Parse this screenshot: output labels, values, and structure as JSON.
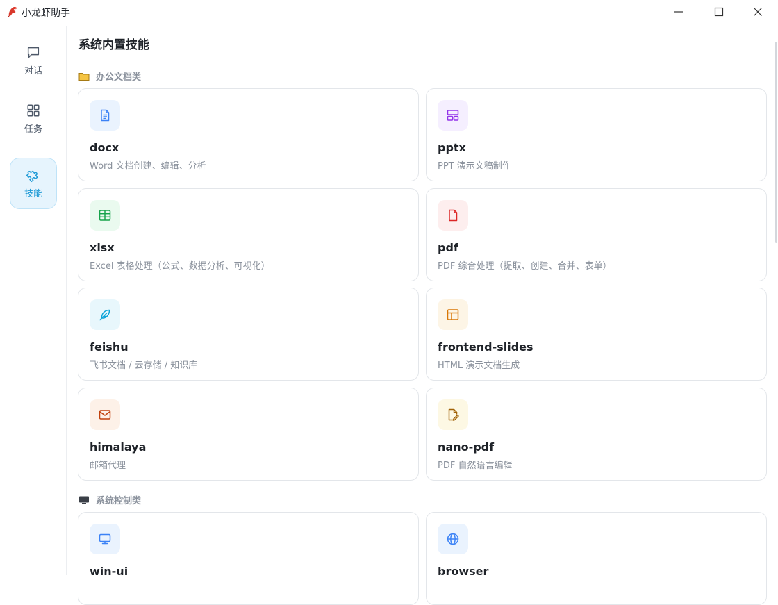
{
  "window": {
    "title": "小龙虾助手",
    "controls": {
      "minimize": "minimize-icon",
      "maximize": "maximize-icon",
      "close": "close-icon"
    }
  },
  "sidebar": {
    "items": [
      {
        "label": "对话",
        "icon": "chat-bubble-icon",
        "active": false
      },
      {
        "label": "任务",
        "icon": "grid-icon",
        "active": false
      },
      {
        "label": "技能",
        "icon": "puzzle-icon",
        "active": true
      }
    ],
    "accent_color": "#1e9ad6"
  },
  "main": {
    "title": "系统内置技能",
    "sections": [
      {
        "label": "办公文档类",
        "icon": "folder-icon",
        "cards": [
          {
            "name": "docx",
            "desc": "Word 文档创建、编辑、分析",
            "icon": "document-icon",
            "color": "#3b82f6",
            "bg": "#eaf3fe"
          },
          {
            "name": "pptx",
            "desc": "PPT 演示文稿制作",
            "icon": "layout-icon",
            "color": "#9333ea",
            "bg": "#f5efff"
          },
          {
            "name": "xlsx",
            "desc": "Excel 表格处理（公式、数据分析、可视化）",
            "icon": "table-icon",
            "color": "#16a34a",
            "bg": "#eafaef"
          },
          {
            "name": "pdf",
            "desc": "PDF 综合处理（提取、创建、合并、表单）",
            "icon": "file-icon",
            "color": "#dc2626",
            "bg": "#fdeeee"
          },
          {
            "name": "feishu",
            "desc": "飞书文档 / 云存储 / 知识库",
            "icon": "feather-icon",
            "color": "#0ea5d9",
            "bg": "#e8f7fc"
          },
          {
            "name": "frontend-slides",
            "desc": "HTML 演示文档生成",
            "icon": "panel-layout-icon",
            "color": "#d97706",
            "bg": "#fdf5e6"
          },
          {
            "name": "himalaya",
            "desc": "邮箱代理",
            "icon": "mail-icon",
            "color": "#c2410c",
            "bg": "#fdf1e8"
          },
          {
            "name": "nano-pdf",
            "desc": "PDF 自然语言编辑",
            "icon": "file-edit-icon",
            "color": "#a16207",
            "bg": "#fdf8e4"
          }
        ]
      },
      {
        "label": "系统控制类",
        "icon": "monitor-icon",
        "cards": [
          {
            "name": "win-ui",
            "desc": "",
            "icon": "monitor-icon",
            "color": "#3b82f6",
            "bg": "#eaf3fe"
          },
          {
            "name": "browser",
            "desc": "",
            "icon": "globe-icon",
            "color": "#3b82f6",
            "bg": "#eaf3fe"
          }
        ]
      }
    ]
  }
}
